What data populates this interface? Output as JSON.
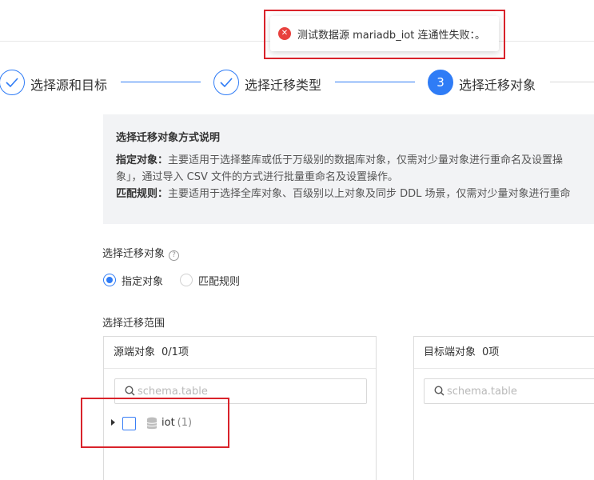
{
  "toast": {
    "message": "测试数据源 mariadb_iot 连通性失败：。",
    "icon": "error-circle-icon",
    "color": "#e8413e"
  },
  "steps": [
    {
      "label": "选择源和目标",
      "status": "done"
    },
    {
      "label": "选择迁移类型",
      "status": "done"
    },
    {
      "number": "3",
      "label": "选择迁移对象",
      "status": "active"
    }
  ],
  "info": {
    "title": "选择迁移对象方式说明",
    "line1_bold": "指定对象：",
    "line1": "主要适用于选择整库或低于万级别的数据库对象，仅需对少量对象进行重命名及设置操",
    "line2": "象」，通过导入 CSV 文件的方式进行批量重命名及设置操作。",
    "line3_bold": "匹配规则：",
    "line3": "主要适用于选择全库对象、百级别以上对象及同步 DDL 场景，仅需对少量对象进行重命"
  },
  "object_selection": {
    "label": "选择迁移对象",
    "options": [
      "指定对象",
      "匹配规则"
    ],
    "selected": "指定对象"
  },
  "scope": {
    "label": "选择迁移范围",
    "source": {
      "title": "源端对象",
      "count": "0/1项",
      "search_placeholder": "schema.table",
      "tree": [
        {
          "name": "iot",
          "count": "(1)"
        }
      ]
    },
    "target": {
      "title": "目标端对象",
      "count": "0项",
      "search_placeholder": "schema.table"
    }
  },
  "colors": {
    "accent": "#2f7cf6",
    "error": "#e8413e",
    "highlight_box": "#d9232b"
  }
}
